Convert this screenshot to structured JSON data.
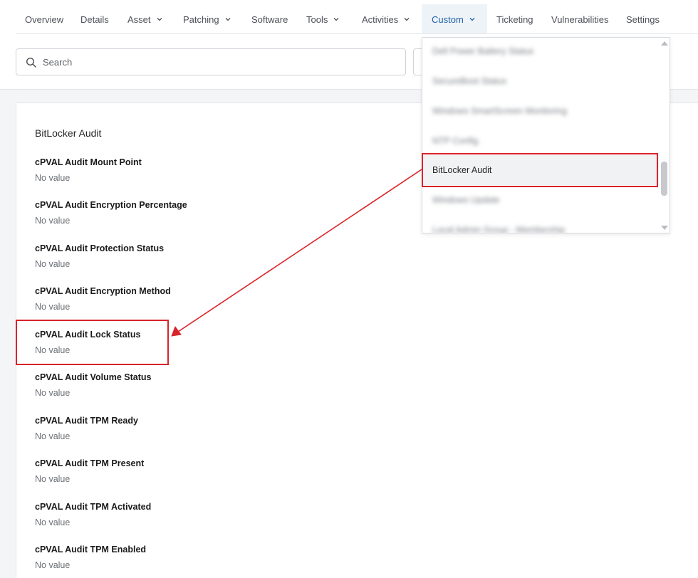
{
  "nav": {
    "tabs": [
      {
        "label": "Overview",
        "dropdown": false
      },
      {
        "label": "Details",
        "dropdown": false
      },
      {
        "label": "Asset",
        "dropdown": true
      },
      {
        "label": "Patching",
        "dropdown": true
      },
      {
        "label": "Software",
        "dropdown": false
      },
      {
        "label": "Tools",
        "dropdown": true
      },
      {
        "label": "Activities",
        "dropdown": true
      },
      {
        "label": "Custom",
        "dropdown": true,
        "active": true
      },
      {
        "label": "Ticketing",
        "dropdown": false
      },
      {
        "label": "Vulnerabilities",
        "dropdown": false
      },
      {
        "label": "Settings",
        "dropdown": false
      }
    ]
  },
  "search": {
    "placeholder": "Search",
    "value": ""
  },
  "dropdown": {
    "items": [
      {
        "label": "Dell Power Battery Status",
        "blurred": true
      },
      {
        "label": "SecureBoot Status",
        "blurred": true
      },
      {
        "label": "Windows SmartScreen Monitoring",
        "blurred": true
      },
      {
        "label": "NTP Config",
        "blurred": true
      },
      {
        "label": "BitLocker Audit",
        "blurred": false,
        "selected": true
      },
      {
        "label": "Windows Update",
        "blurred": true
      },
      {
        "label": "Local Admin Group - Membership",
        "blurred": true
      }
    ]
  },
  "section": {
    "title": "BitLocker Audit",
    "fields": [
      {
        "label": "cPVAL Audit Mount Point",
        "value": "No value"
      },
      {
        "label": "cPVAL Audit Encryption Percentage",
        "value": "No value"
      },
      {
        "label": "cPVAL Audit Protection Status",
        "value": "No value"
      },
      {
        "label": "cPVAL Audit Encryption Method",
        "value": "No value"
      },
      {
        "label": "cPVAL Audit Lock Status",
        "value": "No value"
      },
      {
        "label": "cPVAL Audit Volume Status",
        "value": "No value"
      },
      {
        "label": "cPVAL Audit TPM Ready",
        "value": "No value"
      },
      {
        "label": "cPVAL Audit TPM Present",
        "value": "No value"
      },
      {
        "label": "cPVAL Audit TPM Activated",
        "value": "No value"
      },
      {
        "label": "cPVAL Audit TPM Enabled",
        "value": "No value"
      }
    ]
  },
  "colors": {
    "accent": "#1f5fa6",
    "annotation": "#d8232a",
    "active_tab_bg": "#eef3f8"
  },
  "icons": {
    "search": "search-icon",
    "tab_dropdown": "chevron-down-icon"
  }
}
